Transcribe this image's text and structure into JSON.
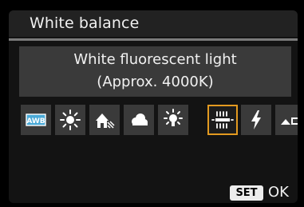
{
  "header": {
    "title": "White balance"
  },
  "description": {
    "line1": "White fluorescent light",
    "line2": "(Approx. 4000K)"
  },
  "options": [
    {
      "id": "awb",
      "label": "AWB",
      "icon": "awb-icon"
    },
    {
      "id": "daylight",
      "label": "",
      "icon": "sun-icon"
    },
    {
      "id": "shade",
      "label": "",
      "icon": "house-shade-icon"
    },
    {
      "id": "cloudy",
      "label": "",
      "icon": "cloud-icon"
    },
    {
      "id": "tungsten",
      "label": "",
      "icon": "bulb-icon"
    },
    {
      "id": "white-fluorescent",
      "label": "",
      "icon": "fluorescent-icon"
    },
    {
      "id": "flash",
      "label": "",
      "icon": "flash-icon"
    },
    {
      "id": "custom",
      "label": "",
      "icon": "custom-wb-icon"
    }
  ],
  "selected_option": "white-fluorescent",
  "footer": {
    "set_label": "SET",
    "ok_label": "OK"
  },
  "colors": {
    "selection": "#e39a20",
    "awb_badge": "#49a9d7"
  }
}
